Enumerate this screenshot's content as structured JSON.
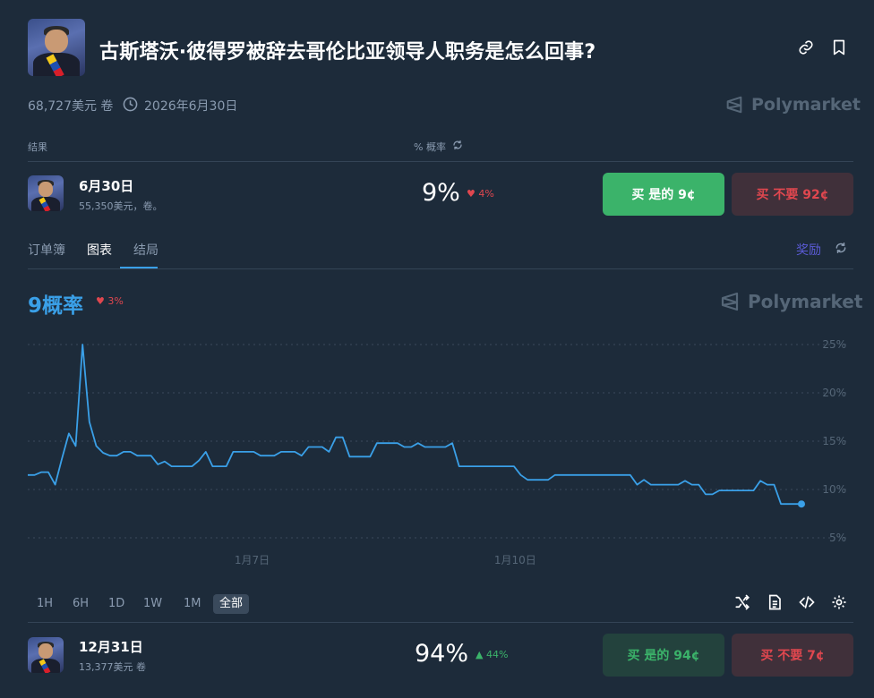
{
  "header": {
    "title": "古斯塔沃·彼得罗被辞去哥伦比亚领导人职务是怎么回事?",
    "volume": "68,727美元 卷",
    "date": "2026年6月30日",
    "brand": "Polymarket"
  },
  "table": {
    "col_outcome": "结果",
    "col_prob": "% 概率"
  },
  "outcome1": {
    "name": "6月30日",
    "volume": "55,350美元，卷。",
    "prob": "9%",
    "change": "4%",
    "change_dir": "down",
    "buy_yes": "买 是的 9¢",
    "buy_no": "买 不要 92¢"
  },
  "tabs": {
    "orderbook": "订单簿",
    "chart": "图表",
    "resolution": "结局",
    "rewards": "奖励"
  },
  "chart_header": {
    "prob_label": "9概率",
    "change": "3%",
    "brand": "Polymarket"
  },
  "chart_data": {
    "type": "line",
    "x": [
      0,
      1,
      2,
      3,
      4,
      5,
      6,
      7,
      8,
      9,
      10,
      11,
      12,
      13,
      14,
      15,
      16,
      17,
      18,
      19,
      20,
      21,
      22,
      23,
      24,
      25,
      26,
      27,
      28,
      29,
      30,
      31,
      32,
      33,
      34,
      35,
      36,
      37,
      38,
      39,
      40,
      41,
      42,
      43,
      44,
      45,
      46,
      47,
      48,
      49,
      50,
      51,
      52,
      53,
      54,
      55,
      56,
      57,
      58,
      59,
      60,
      61,
      62,
      63,
      64,
      65,
      66,
      67,
      68,
      69,
      70,
      71,
      72,
      73,
      74,
      75,
      76,
      77,
      78,
      79,
      80,
      81,
      82,
      83,
      84,
      85,
      86,
      87,
      88,
      89,
      90,
      91,
      92,
      93,
      94,
      95,
      96,
      97,
      98,
      99,
      100
    ],
    "series": [
      {
        "values": [
          11.5,
          11.5,
          11.8,
          11.8,
          10.5,
          13.2,
          15.8,
          14.5,
          25.0,
          17.0,
          14.5,
          13.8,
          13.5,
          13.5,
          13.9,
          13.9,
          13.5,
          13.5,
          13.5,
          12.6,
          12.9,
          12.4,
          12.4,
          12.4,
          12.4,
          13.0,
          13.9,
          12.4,
          12.4,
          12.4,
          13.9,
          13.9,
          13.9,
          13.9,
          13.5,
          13.5,
          13.5,
          13.9,
          13.9,
          13.9,
          13.5,
          14.4,
          14.4,
          14.4,
          13.9,
          15.4,
          15.4,
          13.4,
          13.4,
          13.4,
          13.4,
          14.8,
          14.8,
          14.8,
          14.8,
          14.4,
          14.4,
          14.8,
          14.4,
          14.4,
          14.4,
          14.4,
          14.8,
          12.4,
          12.4,
          12.4,
          12.4,
          12.4,
          12.4,
          12.4,
          12.4,
          12.4,
          11.5,
          11.0,
          11.0,
          11.0,
          11.0,
          11.5,
          11.5,
          11.5,
          11.5,
          11.5,
          11.5,
          11.5,
          11.5,
          11.5,
          11.5,
          11.5,
          11.5,
          10.5,
          11.0,
          10.5,
          10.5,
          10.5,
          10.5,
          10.5,
          10.9,
          10.5,
          10.5,
          9.5,
          9.5,
          9.9,
          9.9,
          9.9,
          9.9,
          9.9,
          9.9,
          10.9,
          10.5,
          10.5,
          8.5,
          8.5,
          8.5,
          8.5
        ]
      }
    ],
    "x_ticks": [
      {
        "label": "1月7日",
        "at": 29
      },
      {
        "label": "1月10日",
        "at": 63
      }
    ],
    "y_ticks": [
      "25%",
      "20%",
      "15%",
      "10%",
      "5%"
    ],
    "y_tick_values": [
      25,
      20,
      15,
      10,
      5
    ],
    "ylim": [
      4,
      26
    ],
    "color": "#3aa0e8",
    "grid": true
  },
  "ranges": [
    "1H",
    "6H",
    "1D",
    "1W",
    "1M",
    "全部"
  ],
  "active_range": "全部",
  "tool_icons": [
    "shuffle-icon",
    "document-icon",
    "code-icon",
    "gear-icon"
  ],
  "outcome2": {
    "name": "12月31日",
    "volume": "13,377美元 卷",
    "prob": "94%",
    "change": "44%",
    "change_dir": "up",
    "buy_yes": "买 是的 94¢",
    "buy_no": "买 不要 7¢"
  },
  "colors": {
    "bg": "#1d2b3a",
    "accent": "#3aa0e8",
    "green": "#3bb36a",
    "red": "#e0474f",
    "rewards": "#5b5bd6"
  }
}
